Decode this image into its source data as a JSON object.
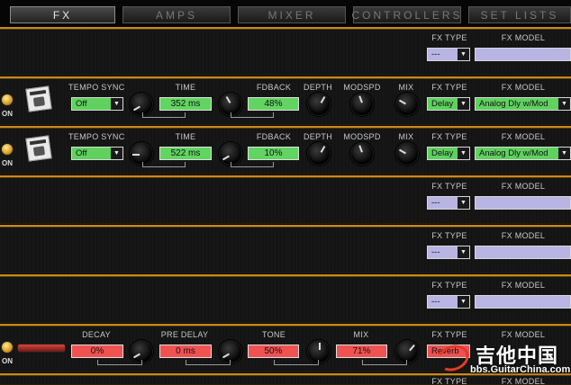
{
  "tabs": [
    "FX",
    "AMPS",
    "MIXER",
    "CONTROLLERS",
    "SET LISTS"
  ],
  "labels": {
    "fx_type": "FX TYPE",
    "fx_model": "FX MODEL",
    "tempo_sync": "TEMPO SYNC",
    "time": "TIME",
    "fdback": "FDBACK",
    "depth": "DEPTH",
    "modspd": "MODSPD",
    "mix": "MIX",
    "on": "ON",
    "decay": "DECAY",
    "pre_delay": "PRE DELAY",
    "tone": "TONE"
  },
  "slots": [
    {
      "fx_type": "---",
      "fx_model": ""
    },
    {
      "fx_type": "Delay",
      "fx_model": "Analog Dly w/Mod",
      "tempo_sync": "Off",
      "time": "352 ms",
      "fdback": "48%"
    },
    {
      "fx_type": "Delay",
      "fx_model": "Analog Dly w/Mod",
      "tempo_sync": "Off",
      "time": "522 ms",
      "fdback": "10%"
    },
    {
      "fx_type": "---",
      "fx_model": ""
    },
    {
      "fx_type": "---",
      "fx_model": ""
    },
    {
      "fx_type": "---",
      "fx_model": ""
    },
    {
      "fx_type": "Reverb",
      "fx_model": "",
      "decay": "0%",
      "pre_delay": "0 ms",
      "tone": "50%",
      "mix": "71%"
    }
  ],
  "watermark": {
    "title": "吉他中国",
    "url": "bbs.GuitarChina.com"
  },
  "colors": {
    "accent": "#c98a1c",
    "green": "#62d462",
    "red": "#f05252",
    "lavender": "#b8b4e4"
  }
}
